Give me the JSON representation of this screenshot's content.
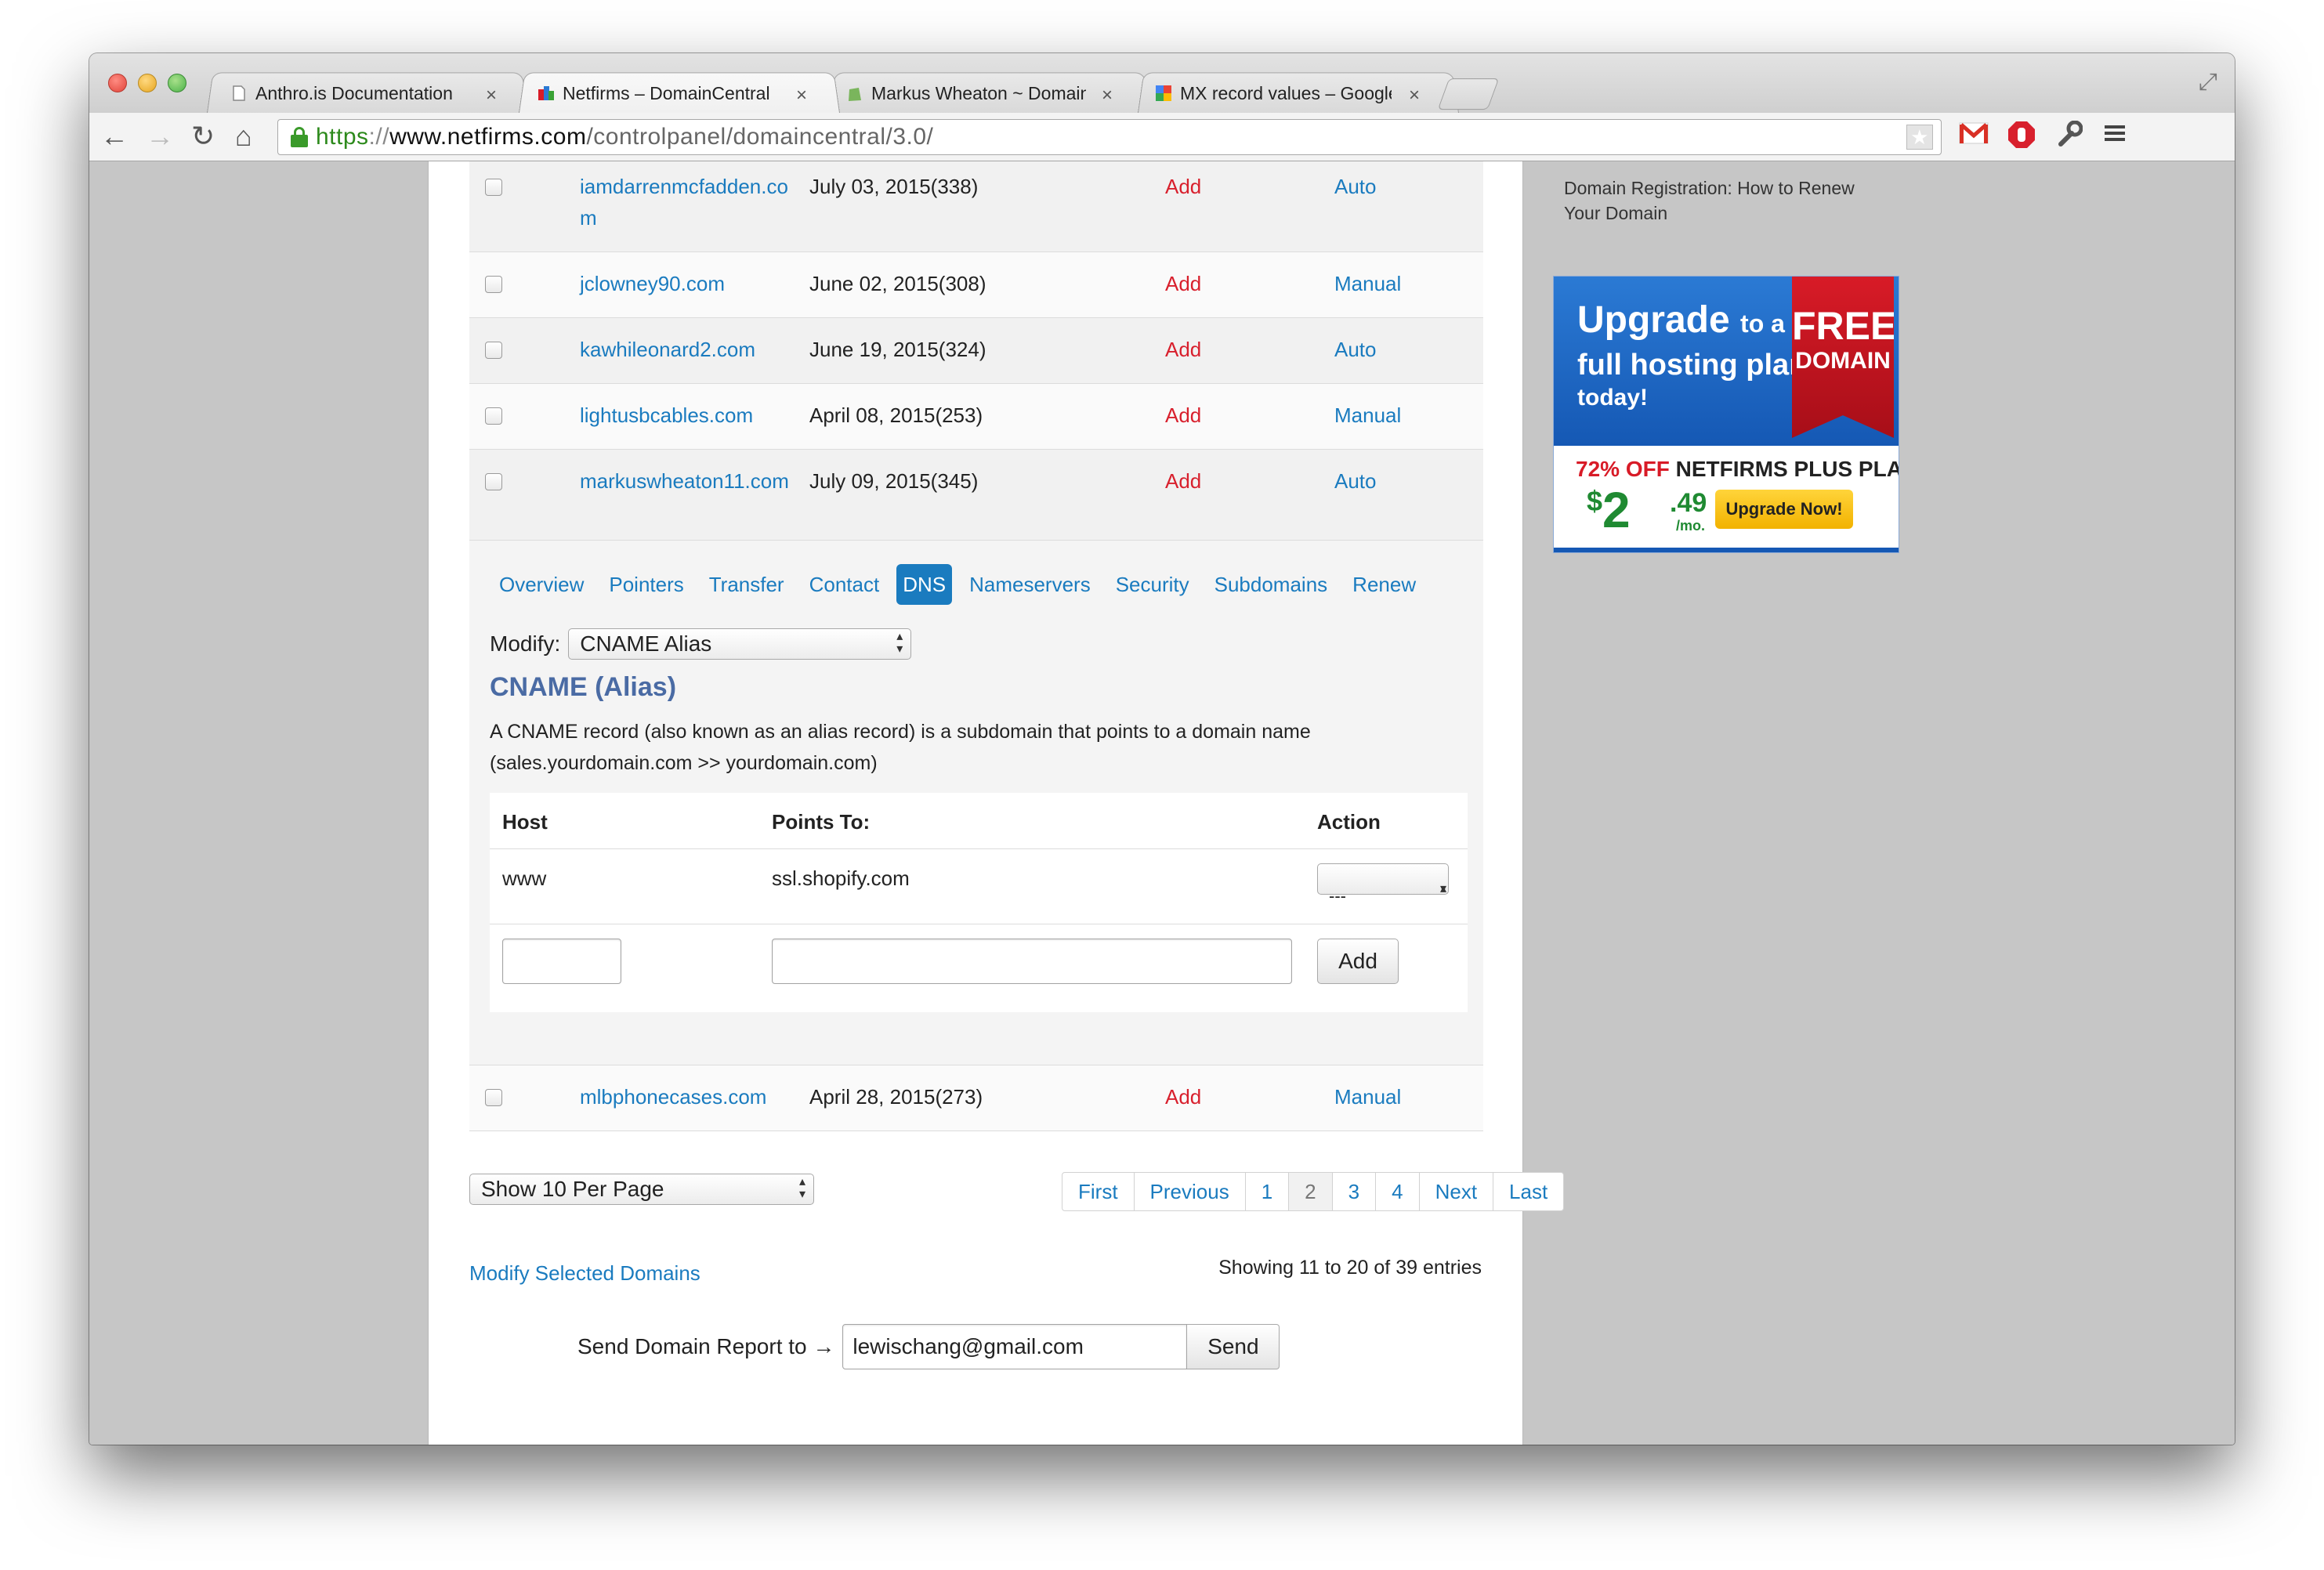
{
  "browser": {
    "tabs": [
      {
        "title": "Anthro.is Documentation",
        "icon": "page-icon"
      },
      {
        "title": "Netfirms – DomainCentral",
        "icon": "netfirms-favicon"
      },
      {
        "title": "Markus Wheaton ~ Domain",
        "icon": "shopify-favicon"
      },
      {
        "title": "MX record values – Google",
        "icon": "google-favicon"
      }
    ],
    "tab_close_glyph": "×",
    "url": {
      "scheme": "https",
      "sep": "://",
      "host": "www.netfirms.com",
      "path": "/controlpanel/domaincentral/3.0/"
    }
  },
  "domains": [
    {
      "name": "iamdarrenmcfadden.com",
      "expires": "July 03, 2015(338)",
      "privacy": "Add",
      "renew": "Auto"
    },
    {
      "name": "jclowney90.com",
      "expires": "June 02, 2015(308)",
      "privacy": "Add",
      "renew": "Manual"
    },
    {
      "name": "kawhileonard2.com",
      "expires": "June 19, 2015(324)",
      "privacy": "Add",
      "renew": "Auto"
    },
    {
      "name": "lightusbcables.com",
      "expires": "April 08, 2015(253)",
      "privacy": "Add",
      "renew": "Manual"
    },
    {
      "name": "markuswheaton11.com",
      "expires": "July 09, 2015(345)",
      "privacy": "Add",
      "renew": "Auto"
    },
    {
      "name": "mlbphonecases.com",
      "expires": "April 28, 2015(273)",
      "privacy": "Add",
      "renew": "Manual"
    }
  ],
  "dns_panel": {
    "tabs": [
      "Overview",
      "Pointers",
      "Transfer",
      "Contact",
      "DNS",
      "Nameservers",
      "Security",
      "Subdomains",
      "Renew"
    ],
    "active_tab": "DNS",
    "modify_label": "Modify:",
    "modify_value": "CNAME Alias",
    "title": "CNAME (Alias)",
    "description_line1": "A CNAME record (also known as an alias record) is a subdomain that points to a domain name",
    "description_line2": "(sales.yourdomain.com >> yourdomain.com)",
    "columns": {
      "host": "Host",
      "points_to": "Points To:",
      "action": "Action"
    },
    "record": {
      "host": "www",
      "points_to": "ssl.shopify.com",
      "action": "---"
    },
    "new_record": {
      "host": "",
      "points_to": "",
      "add_label": "Add"
    }
  },
  "footer": {
    "per_page": "Show 10 Per Page",
    "pagination": [
      "First",
      "Previous",
      "1",
      "2",
      "3",
      "4",
      "Next",
      "Last"
    ],
    "current_page": "2",
    "modify_selected": "Modify Selected Domains",
    "showing": "Showing 11 to 20 of 39 entries",
    "report_label": "Send Domain Report to →",
    "report_email": "lewischang@gmail.com",
    "send_label": "Send"
  },
  "sidebar": {
    "link": "Domain Registration: How to Renew Your Domain",
    "ad": {
      "upgrade": "Upgrade",
      "to_a": "to a",
      "full_plan": "full hosting plan",
      "today": "today!",
      "free": "FREE",
      "domain": "DOMAIN",
      "pct_off": "72% OFF",
      "plan": "NETFIRMS PLUS PLAN",
      "dollar": "$",
      "price_int": "2",
      "price_cents": ".49",
      "per": "/mo.",
      "cta": "Upgrade Now!"
    }
  },
  "colors": {
    "link": "#1a7bbf",
    "add_red": "#d8202d",
    "cname_title": "#4a6ba4",
    "secure_green": "#2d8a1c"
  }
}
